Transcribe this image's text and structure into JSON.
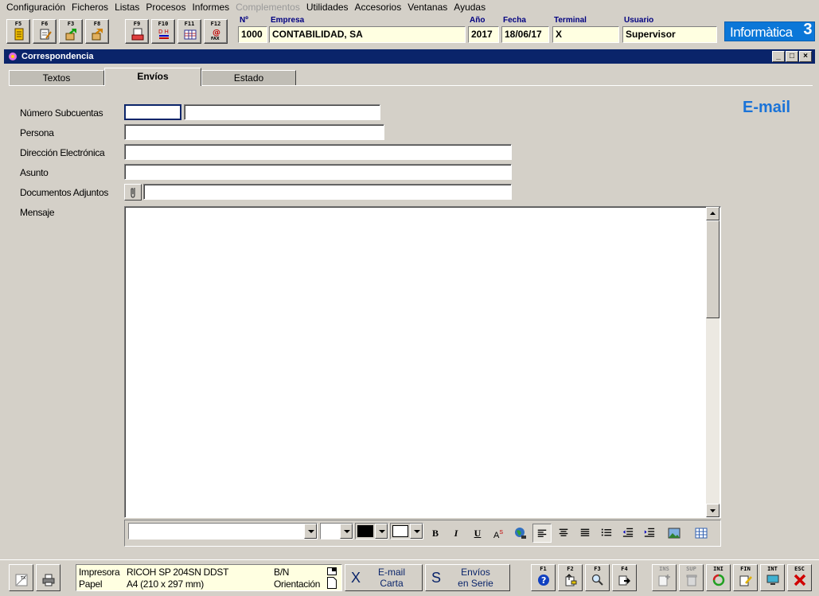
{
  "menu": [
    "Configuración",
    "Ficheros",
    "Listas",
    "Procesos",
    "Informes",
    "Complementos",
    "Utilidades",
    "Accesorios",
    "Ventanas",
    "Ayudas"
  ],
  "toolbar_keys": {
    "f5": "F5",
    "f6": "F6",
    "f3": "F3",
    "f8": "F8",
    "f9": "F9",
    "f10": "F10",
    "f11": "F11",
    "f12": "F12"
  },
  "header": {
    "num_label": "Nº",
    "num_value": "1000",
    "empresa_label": "Empresa",
    "empresa_value": "CONTABILIDAD, SA",
    "anio_label": "Año",
    "anio_value": "2017",
    "fecha_label": "Fecha",
    "fecha_value": "18/06/17",
    "terminal_label": "Terminal",
    "terminal_value": "X",
    "usuario_label": "Usuario",
    "usuario_value": "Supervisor"
  },
  "brand": {
    "text": "Informàtica",
    "suffix": "3"
  },
  "window": {
    "title": "Correspondencia",
    "min": "_",
    "max": "□",
    "close": "×"
  },
  "tabs": {
    "textos": "Textos",
    "envios": "Envíos",
    "estado": "Estado"
  },
  "form": {
    "heading": "E-mail",
    "subcuentas_label": "Número Subcuentas",
    "persona_label": "Persona",
    "direccion_label": "Dirección Electrónica",
    "asunto_label": "Asunto",
    "adjuntos_label": "Documentos Adjuntos",
    "mensaje_label": "Mensaje"
  },
  "format": {
    "bold": "B",
    "italic": "I",
    "underline": "U",
    "superscript": "A"
  },
  "printer": {
    "impresora_label": "Impresora",
    "impresora_value": "RICOH SP 204SN DDST",
    "papel_label": "Papel",
    "papel_value": "A4 (210 x 297 mm)",
    "color_value": "B/N",
    "orientacion_label": "Orientación"
  },
  "actions": {
    "email_key": "X",
    "email_line1": "E-mail",
    "email_line2": "Carta",
    "serie_key": "S",
    "serie_line1": "Envíos",
    "serie_line2": "en Serie"
  },
  "bottom_keys": {
    "f1": "F1",
    "f2": "F2",
    "f3": "F3",
    "f4": "F4",
    "ins": "INS",
    "sup": "SUP",
    "ini": "INI",
    "fin": "FIN",
    "int": "INT",
    "esc": "ESC"
  },
  "colors": {
    "accent": "#1a73d8",
    "titlebar": "#0a246a",
    "field_bg": "#ffffe1",
    "brand_bg": "#0b77d8"
  }
}
